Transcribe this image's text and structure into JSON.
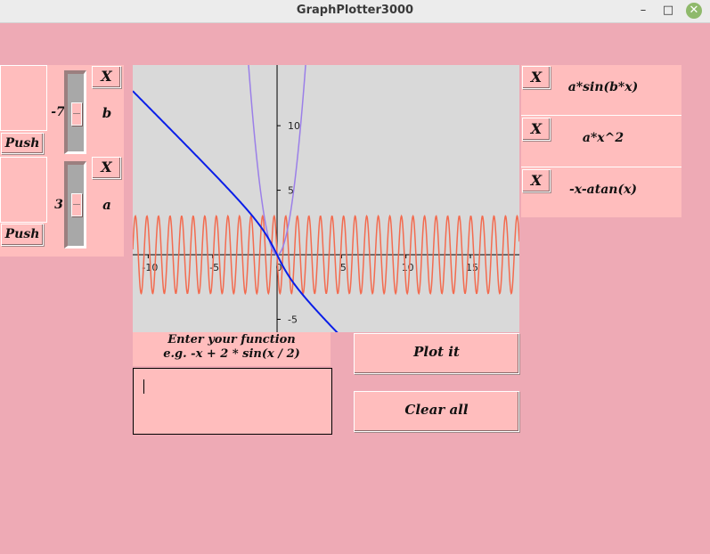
{
  "window": {
    "title": "GraphPlotter3000",
    "min": "–",
    "max": "□",
    "close": "✕"
  },
  "sliders": [
    {
      "value": "-7",
      "param": "b",
      "push_label": "Push",
      "remove_label": "X"
    },
    {
      "value": "3",
      "param": "a",
      "push_label": "Push",
      "remove_label": "X"
    }
  ],
  "functions": [
    {
      "remove_label": "X",
      "expr": "a*sin(b*x)"
    },
    {
      "remove_label": "X",
      "expr": "a*x^2"
    },
    {
      "remove_label": "X",
      "expr": "-x-atan(x)"
    }
  ],
  "input": {
    "heading_line1": "Enter your function",
    "heading_line2": "e.g. -x + 2 * sin(x / 2)",
    "value": ""
  },
  "buttons": {
    "plot": "Plot it",
    "clear": "Clear all"
  },
  "chart_data": {
    "type": "line",
    "x_ticks": [
      "-10",
      "-5",
      "0",
      "5",
      "10",
      "15"
    ],
    "y_ticks": [
      "-5",
      "5",
      "10"
    ],
    "xlim": [
      -11.2,
      18.8
    ],
    "ylim": [
      -6.0,
      14.7
    ],
    "grid": false,
    "series": [
      {
        "name": "a*sin(b*x)",
        "color": "#f36b4f",
        "a": 3,
        "b": -7
      },
      {
        "name": "a*x^2",
        "color": "#9b7fe8",
        "a": 3
      },
      {
        "name": "-x-atan(x)",
        "color": "#0a1ee8"
      }
    ]
  }
}
